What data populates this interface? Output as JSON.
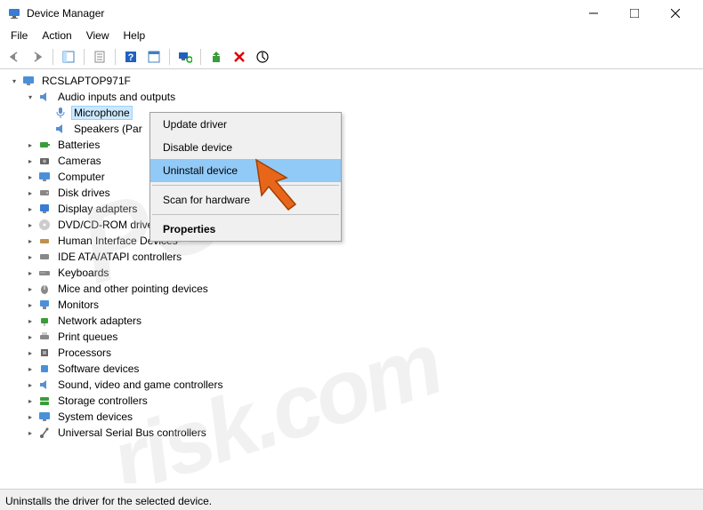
{
  "window": {
    "title": "Device Manager"
  },
  "menu": {
    "file": "File",
    "action": "Action",
    "view": "View",
    "help": "Help"
  },
  "tree": {
    "root": "RCSLAPTOP971F",
    "audio": "Audio inputs and outputs",
    "microphone": "Microphone",
    "speakers": "Speakers (Par",
    "batteries": "Batteries",
    "cameras": "Cameras",
    "computer": "Computer",
    "disk": "Disk drives",
    "display": "Display adapters",
    "dvd": "DVD/CD-ROM drives",
    "hid": "Human Interface Devices",
    "ide": "IDE ATA/ATAPI controllers",
    "keyboards": "Keyboards",
    "mice": "Mice and other pointing devices",
    "monitors": "Monitors",
    "network": "Network adapters",
    "print": "Print queues",
    "processors": "Processors",
    "software": "Software devices",
    "sound": "Sound, video and game controllers",
    "storage": "Storage controllers",
    "system": "System devices",
    "usb": "Universal Serial Bus controllers"
  },
  "context": {
    "update": "Update driver",
    "disable": "Disable device",
    "uninstall": "Uninstall device",
    "scan": "Scan for hardware",
    "properties": "Properties"
  },
  "status": {
    "text": "Uninstalls the driver for the selected device."
  },
  "watermark": {
    "a": "PC",
    "b": "risk.com"
  }
}
